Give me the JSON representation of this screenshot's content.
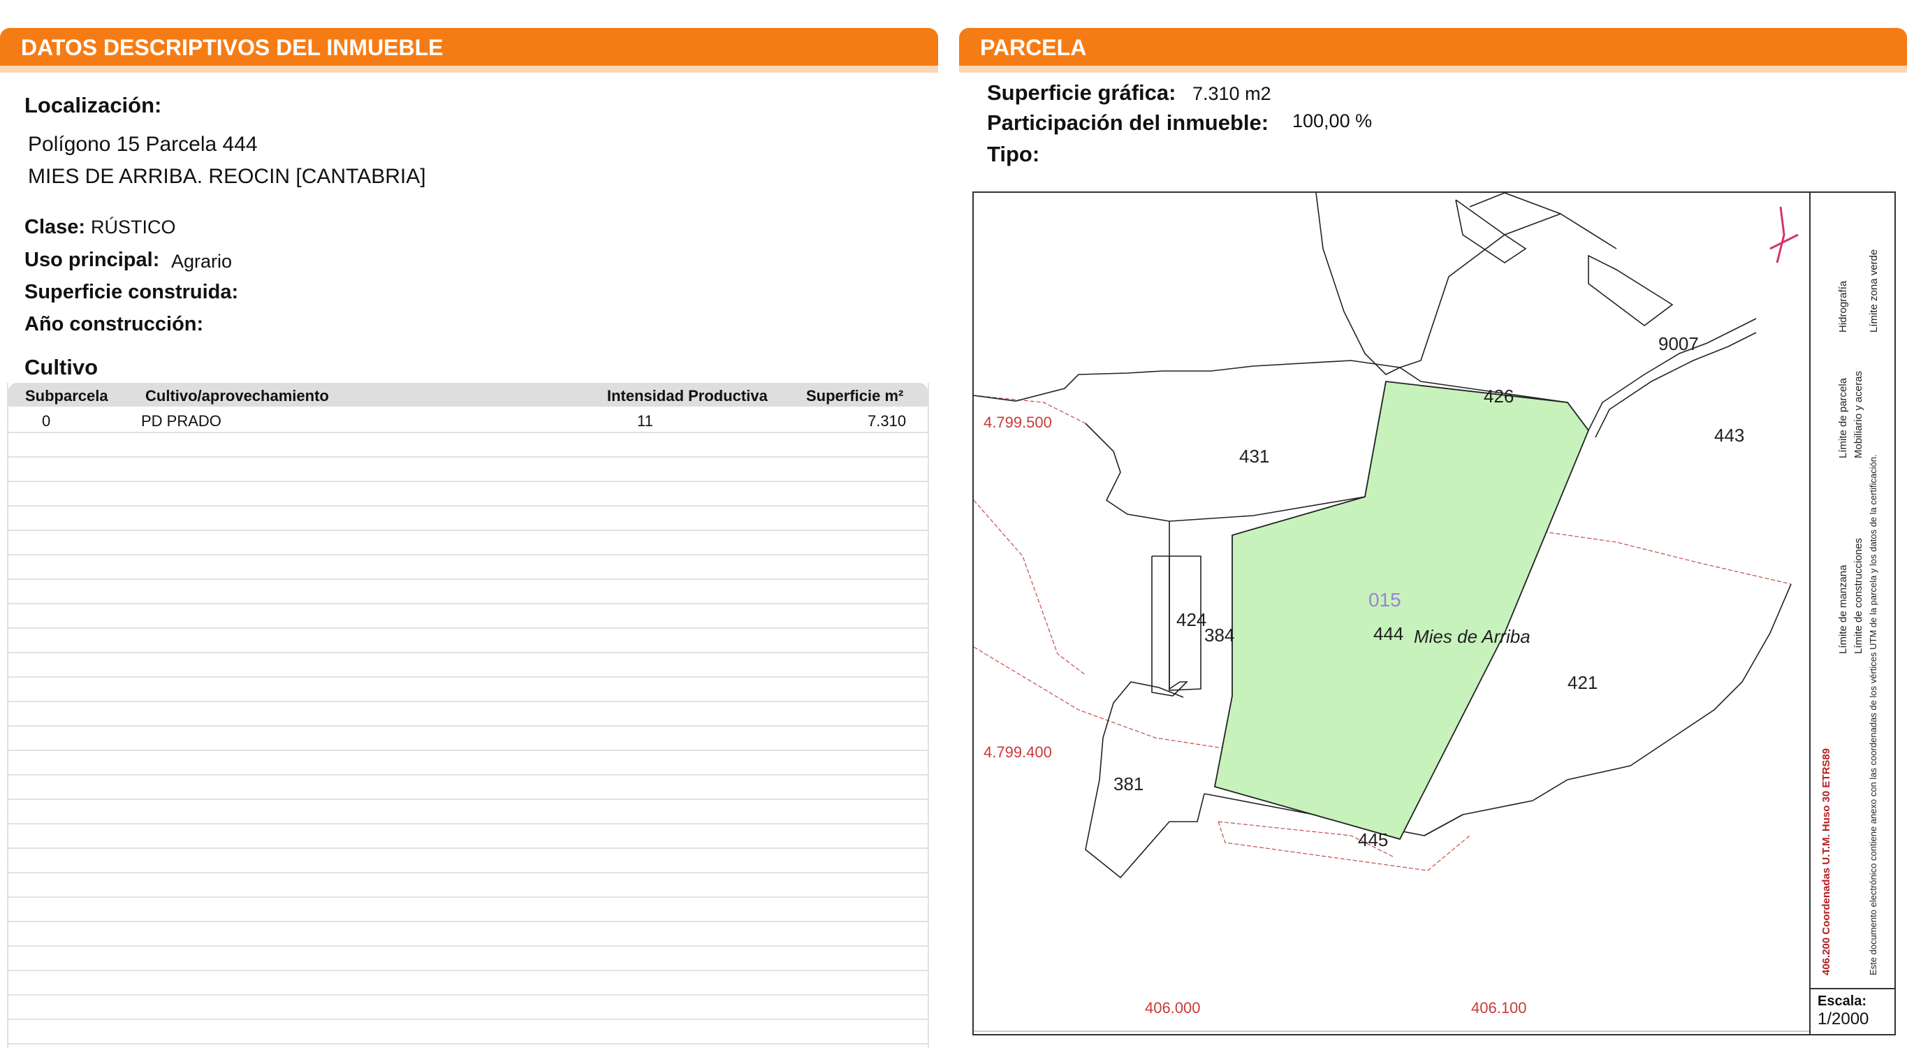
{
  "left": {
    "title_prefix": "DATOS DESCRIPTIVOS DEL ",
    "title_bold": "INMUEBLE",
    "localizacion_label": "Localización:",
    "address_line1": "Polígono 15 Parcela 444",
    "address_line2": "MIES DE ARRIBA. REOCIN [CANTABRIA]",
    "clase_label": "Clase:",
    "clase_value": "RÚSTICO",
    "uso_label": "Uso principal:",
    "uso_value": "Agrario",
    "superficie_construida_label": "Superficie construida:",
    "anio_label": "Año construcción:",
    "cultivo_title": "Cultivo",
    "table": {
      "headers": [
        "Subparcela",
        "Cultivo/aprovechamiento",
        "Intensidad Productiva",
        "Superficie m²"
      ],
      "rows": [
        [
          "0",
          "PD PRADO",
          "11",
          "7.310"
        ]
      ]
    }
  },
  "right": {
    "title": "PARCELA",
    "superficie_label": "Superficie gráfica:",
    "superficie_value": "7.310 m2",
    "participacion_label": "Participación del inmueble:",
    "participacion_value": "100,00 %",
    "tipo_label": "Tipo:",
    "map": {
      "parcel_labels": [
        "426",
        "431",
        "443",
        "424",
        "384",
        "444",
        "421",
        "381",
        "445",
        "9007"
      ],
      "subject_label": "015",
      "place_name": "Mies de Arriba",
      "coord_labels": [
        "4.799.500",
        "4.799.400",
        "406.000",
        "406.100"
      ],
      "subject_fill": "#c7f2bc",
      "legend": [
        "Límite de manzana",
        "Límite de parcela",
        "Límite de construcciones",
        "Mobiliario y aceras",
        "Límite zona verde",
        "Hidrografía"
      ],
      "coord_note": "406.200 Coordenadas U.T.M. Huso 30 ETRS89",
      "doc_note": "Este documento electrónico contiene anexo con las coordenadas de los vértices UTM de la parcela y los datos de la certificación.",
      "escala_label": "Escala:",
      "escala_value": "1/2000"
    }
  },
  "colors": {
    "banner": "#f57c14",
    "accent_red": "#c83a3a"
  }
}
